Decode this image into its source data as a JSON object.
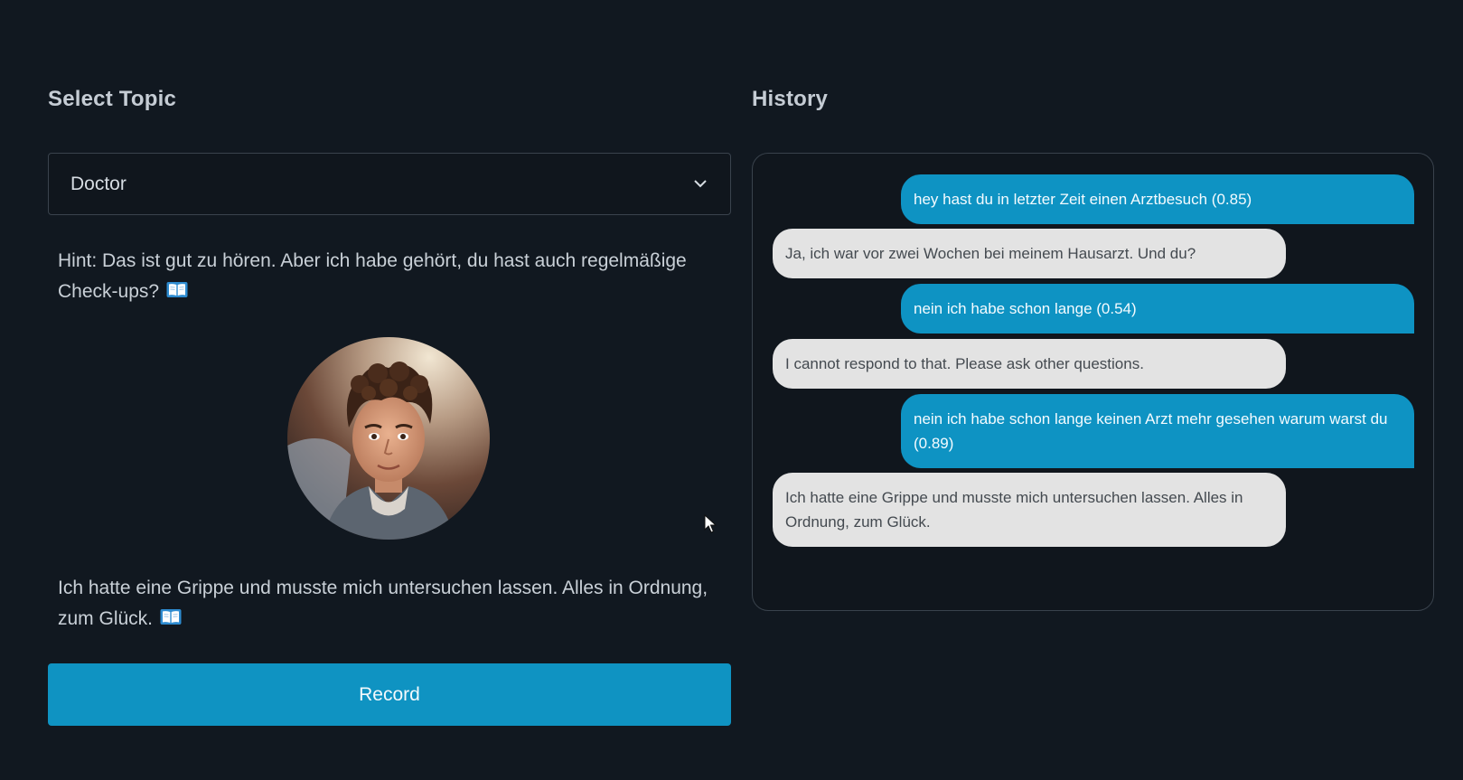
{
  "topic": {
    "title": "Select Topic",
    "selected": "Doctor"
  },
  "hint": {
    "text": "Hint: Das ist gut zu hören. Aber ich habe gehört, du hast auch regelmäßige Check-ups?",
    "icon": "book-icon"
  },
  "response": {
    "text": "Ich hatte eine Grippe und musste mich untersuchen lassen. Alles in Ordnung, zum Glück.",
    "icon": "book-icon"
  },
  "record_label": "Record",
  "history": {
    "title": "History",
    "messages": [
      {
        "role": "user",
        "text": "hey hast du in letzter Zeit einen Arztbesuch (0.85)"
      },
      {
        "role": "bot",
        "text": "Ja, ich war vor zwei Wochen bei meinem Hausarzt. Und du?"
      },
      {
        "role": "user",
        "text": "nein ich habe schon lange (0.54)"
      },
      {
        "role": "bot",
        "text": "I cannot respond to that. Please ask other questions."
      },
      {
        "role": "user",
        "text": "nein ich habe schon lange keinen Arzt mehr gesehen warum warst du (0.89)"
      },
      {
        "role": "bot",
        "text": "Ich hatte eine Grippe und musste mich untersuchen lassen. Alles in Ordnung, zum Glück."
      }
    ]
  },
  "colors": {
    "background": "#111820",
    "accent": "#0f93c2",
    "user_bubble": "#0e93c3",
    "bot_bubble": "#e3e3e3"
  }
}
